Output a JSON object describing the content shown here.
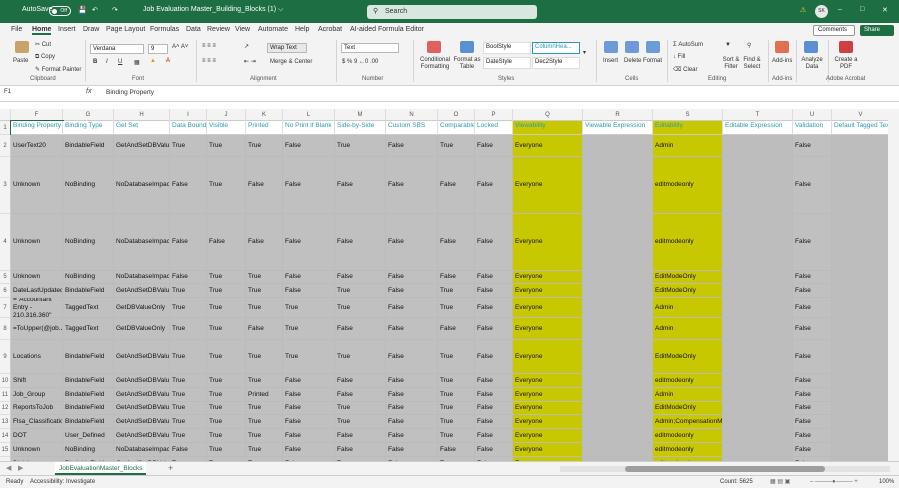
{
  "titlebar": {
    "autosave": "AutoSave",
    "autosave_state": "Off",
    "title": "Job Evaluation Master_Building_Blocks (1) ⌵",
    "search_placeholder": "Search",
    "avatar": "SK"
  },
  "menu": [
    "File",
    "Home",
    "Insert",
    "Draw",
    "Page Layout",
    "Formulas",
    "Data",
    "Review",
    "View",
    "Automate",
    "Help",
    "Acrobat",
    "AI-aided Formula Editor"
  ],
  "menu_active": "Home",
  "comments": "Comments",
  "share": "Share",
  "ribbon": {
    "clipboard": {
      "paste": "Paste",
      "cut": "Cut",
      "copy": "Copy",
      "format_painter": "Format Painter",
      "label": "Clipboard"
    },
    "font": {
      "name": "Verdana",
      "size": "9",
      "label": "Font"
    },
    "alignment": {
      "wrap": "Wrap Text",
      "merge": "Merge & Center",
      "label": "Alignment"
    },
    "number": {
      "format": "Text",
      "label": "Number"
    },
    "styles": {
      "conditional": "Conditional Formatting",
      "format_table": "Format as Table",
      "s1": "BoolStyle",
      "s2": "ColumnHea...",
      "s3": "DateStyle",
      "s4": "Dec2Style",
      "label": "Styles"
    },
    "cells": {
      "insert": "Insert",
      "delete": "Delete",
      "format": "Format",
      "label": "Cells"
    },
    "editing": {
      "autosum": "AutoSum",
      "fill": "Fill",
      "clear": "Clear",
      "sort": "Sort & Filter",
      "find": "Find & Select",
      "label": "Editing"
    },
    "addins": {
      "addins": "Add-ins",
      "label": "Add-ins"
    },
    "analyze": {
      "label": "Analyze Data"
    },
    "acrobat": {
      "create": "Create a PDF",
      "label": "Adobe Acrobat"
    }
  },
  "formula_bar": {
    "name_box": "F1",
    "fx": "fx",
    "content": "Binding Property"
  },
  "columns": [
    "F",
    "G",
    "H",
    "I",
    "J",
    "K",
    "L",
    "M",
    "N",
    "O",
    "P",
    "Q",
    "R",
    "S",
    "T",
    "U",
    "V"
  ],
  "header_row": [
    "Binding Property",
    "Binding Type",
    "Get Set",
    "Data Bound",
    "Visible",
    "Printed",
    "No Print if Blank",
    "Side-by-Side",
    "Custom SBS",
    "Comparable",
    "Locked",
    "Viewability",
    "Viewable Expression",
    "Editability",
    "Editable Expression",
    "Validation",
    "Default Tagged Text"
  ],
  "rows": [
    {
      "n": "2",
      "cells": [
        "UserText20",
        "BindableField",
        "GetAndSetDBValue",
        "True",
        "True",
        "True",
        "False",
        "True",
        "False",
        "True",
        "False",
        "Everyone",
        "",
        "Admin",
        "",
        "False",
        ""
      ]
    },
    {
      "n": "3",
      "cells": [
        "Unknown",
        "NoBinding",
        "NoDatabaseImpact",
        "False",
        "True",
        "False",
        "False",
        "False",
        "False",
        "False",
        "False",
        "Everyone",
        "",
        "editmodeonly",
        "",
        "False",
        ""
      ]
    },
    {
      "n": "4",
      "cells": [
        "Unknown",
        "NoBinding",
        "NoDatabaseImpact",
        "False",
        "False",
        "False",
        "False",
        "False",
        "False",
        "False",
        "False",
        "Everyone",
        "",
        "editmodeonly",
        "",
        "False",
        ""
      ]
    },
    {
      "n": "5",
      "cells": [
        "Unknown",
        "NoBinding",
        "NoDatabaseImpact",
        "False",
        "True",
        "True",
        "False",
        "False",
        "False",
        "False",
        "False",
        "Everyone",
        "",
        "EditModeOnly",
        "",
        "False",
        ""
      ]
    },
    {
      "n": "6",
      "cells": [
        "DateLastUpdated",
        "BindableField",
        "GetAndSetDBValue",
        "True",
        "True",
        "True",
        "False",
        "True",
        "False",
        "True",
        "False",
        "Everyone",
        "",
        "EditModeOnly",
        "",
        "False",
        ""
      ]
    },
    {
      "n": "7",
      "cells": [
        "=\"Accountant Entry - 210.316.360\"",
        "TaggedText",
        "GetDBValueOnly",
        "True",
        "True",
        "True",
        "True",
        "True",
        "False",
        "True",
        "False",
        "Everyone",
        "",
        "Admin",
        "",
        "False",
        ""
      ]
    },
    {
      "n": "8",
      "cells": [
        "=ToUpper(@job.JobDescName@)",
        "TaggedText",
        "GetDBValueOnly",
        "True",
        "True",
        "False",
        "True",
        "False",
        "False",
        "False",
        "False",
        "Everyone",
        "",
        "Admin",
        "",
        "False",
        ""
      ]
    },
    {
      "n": "9",
      "cells": [
        "Locations",
        "BindableField",
        "GetAndSetDBValue",
        "True",
        "True",
        "True",
        "True",
        "True",
        "False",
        "True",
        "False",
        "Everyone",
        "",
        "EditModeOnly",
        "",
        "False",
        ""
      ]
    },
    {
      "n": "10",
      "cells": [
        "Shift",
        "BindableField",
        "GetAndSetDBValue",
        "True",
        "True",
        "True",
        "False",
        "False",
        "False",
        "True",
        "False",
        "Everyone",
        "",
        "editmodeonly",
        "",
        "False",
        ""
      ]
    },
    {
      "n": "11",
      "cells": [
        "Job_Group",
        "BindableField",
        "GetAndSetDBValue",
        "True",
        "True",
        "Printed",
        "False",
        "False",
        "False",
        "True",
        "False",
        "Everyone",
        "",
        "Admin",
        "",
        "False",
        ""
      ]
    },
    {
      "n": "12",
      "cells": [
        "ReportsToJob",
        "BindableField",
        "GetAndSetDBValue",
        "True",
        "True",
        "True",
        "False",
        "True",
        "False",
        "True",
        "False",
        "Everyone",
        "",
        "EditModeOnly",
        "",
        "False",
        ""
      ]
    },
    {
      "n": "13",
      "cells": [
        "Flsa_Classification",
        "BindableField",
        "GetAndSetDBValue",
        "True",
        "True",
        "True",
        "False",
        "True",
        "False",
        "True",
        "False",
        "Everyone",
        "",
        "Admin;CompensationManager",
        "",
        "False",
        ""
      ]
    },
    {
      "n": "14",
      "cells": [
        "DOT",
        "User_Defined",
        "GetAndSetDBValue",
        "True",
        "True",
        "True",
        "False",
        "False",
        "False",
        "True",
        "False",
        "Everyone",
        "",
        "editmodeonly",
        "",
        "False",
        ""
      ]
    },
    {
      "n": "15",
      "cells": [
        "Unknown",
        "NoBinding",
        "NoDatabaseImpact",
        "False",
        "True",
        "True",
        "False",
        "False",
        "False",
        "False",
        "False",
        "Everyone",
        "",
        "editmodeonly",
        "",
        "False",
        ""
      ]
    },
    {
      "n": "16",
      "cells": [
        "Division",
        "BindableField",
        "GetAndSetDBValue",
        "True",
        "True",
        "True",
        "False",
        "True",
        "False",
        "True",
        "False",
        "Everyone",
        "",
        "editmodeonly",
        "",
        "False",
        ""
      ]
    }
  ],
  "colors": {
    "green": "#1e6e43",
    "highlight": "#c8c800",
    "gray_fill": "#c0c0c0",
    "header_text": "#2a9bb0"
  },
  "sheet_tab": "JobEvaluationMaster_Blocks",
  "status": {
    "ready": "Ready",
    "accessibility": "Accessibility: Investigate",
    "count": "Count: 5625",
    "zoom": "100%"
  }
}
